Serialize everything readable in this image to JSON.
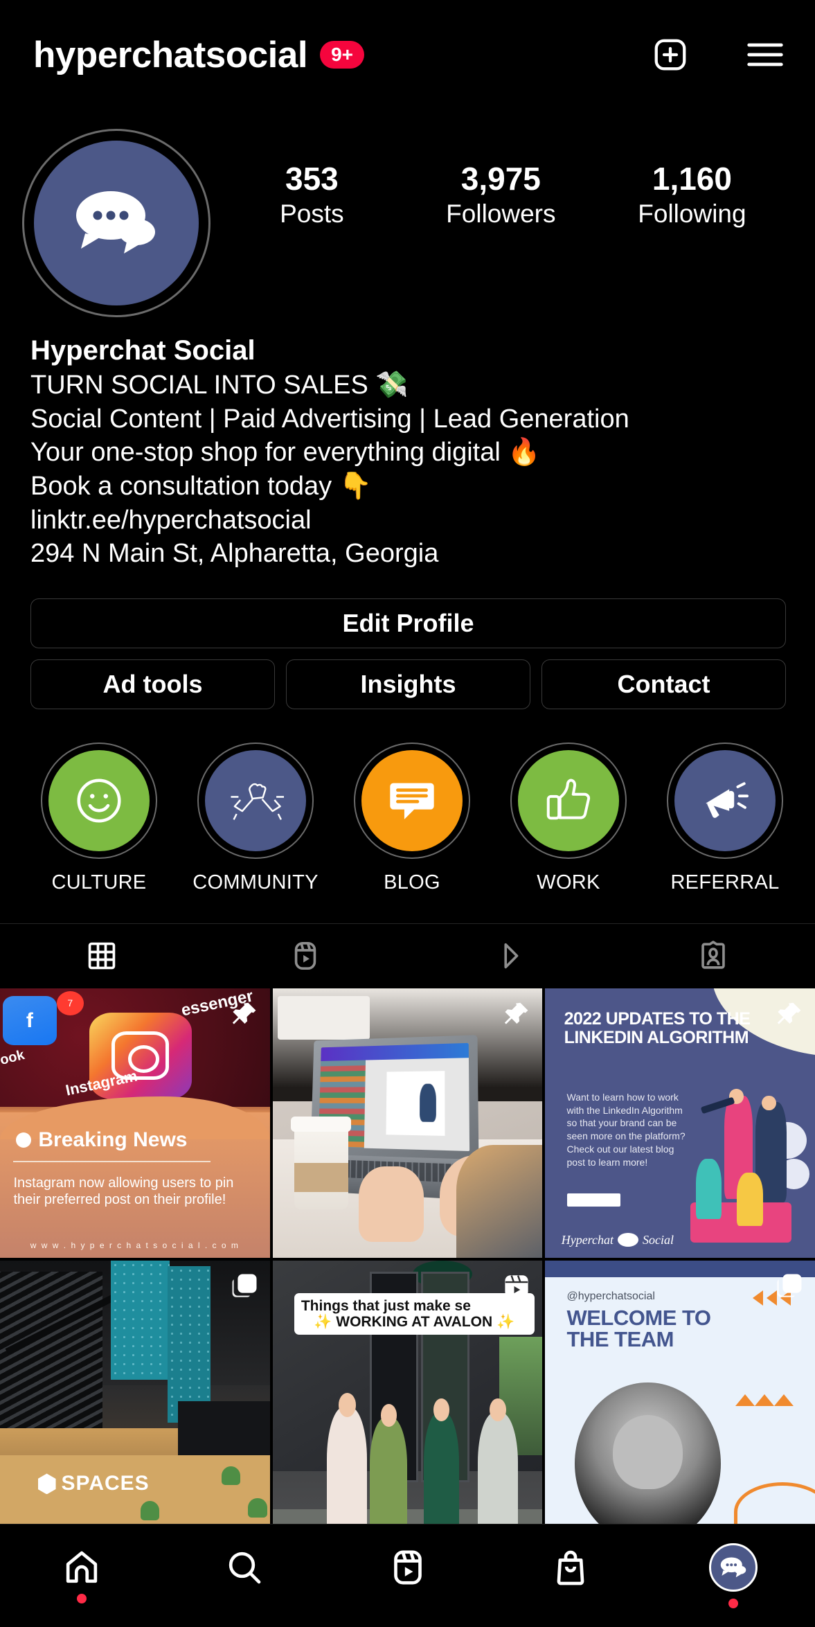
{
  "header": {
    "title": "hyperchatsocial",
    "badge": "9+",
    "add_icon": "plus-square-icon",
    "menu_icon": "hamburger-menu-icon"
  },
  "profile": {
    "avatar_icon": "chat-bubbles-icon",
    "avatar_color": "#4c5888",
    "stats": [
      {
        "value": "353",
        "label": "Posts"
      },
      {
        "value": "3,975",
        "label": "Followers"
      },
      {
        "value": "1,160",
        "label": "Following"
      }
    ],
    "display_name": "Hyperchat Social",
    "bio_lines": [
      "TURN SOCIAL INTO SALES 💸",
      "Social Content | Paid Advertising | Lead Generation",
      "Your one-stop shop for everything digital 🔥",
      "Book a consultation today 👇"
    ],
    "link": "linktr.ee/hyperchatsocial",
    "address": "294 N Main St, Alpharetta, Georgia"
  },
  "actions": {
    "edit_profile": "Edit Profile",
    "ad_tools": "Ad tools",
    "insights": "Insights",
    "contact": "Contact"
  },
  "highlights": [
    {
      "label": "CULTURE",
      "color": "#7dbb42",
      "icon": "smiley-face-icon"
    },
    {
      "label": "COMMUNITY",
      "color": "#4c5888",
      "icon": "handshake-icon"
    },
    {
      "label": "BLOG",
      "color": "#f89a0e",
      "icon": "chat-bubble-lines-icon"
    },
    {
      "label": "WORK",
      "color": "#7dbb42",
      "icon": "thumbs-up-icon"
    },
    {
      "label": "REFERRAL",
      "color": "#4c5888",
      "icon": "megaphone-icon"
    }
  ],
  "tabs": [
    {
      "name": "grid",
      "icon": "grid-icon",
      "active": true
    },
    {
      "name": "reels",
      "icon": "reels-icon",
      "active": false
    },
    {
      "name": "video",
      "icon": "play-icon",
      "active": false
    },
    {
      "name": "tagged",
      "icon": "tagged-icon",
      "active": false
    }
  ],
  "posts": [
    {
      "id": "post-breaking-news",
      "overlay": "pin-icon",
      "heading": "Breaking News",
      "body": "Instagram now allowing users to pin their preferred post on their profile!",
      "url": "w w w . h y p e r c h a t s o c i a l . c o m",
      "labels": {
        "messenger": "essenger",
        "facebook": "ook",
        "instagram": "Instagram",
        "fb_glyph": "f",
        "badge": "7"
      }
    },
    {
      "id": "post-laptop-work",
      "overlay": "pin-icon"
    },
    {
      "id": "post-linkedin-algorithm",
      "overlay": "pin-icon",
      "title": "2022 UPDATES TO THE LINKEDIN ALGORITHM",
      "body": "Want to learn how to work with the LinkedIn Algorithm so that your brand can be seen more on the platform? Check out our latest blog post to learn more!",
      "logo_left": "Hyperchat",
      "logo_right": "Social"
    },
    {
      "id": "post-spaces-office",
      "overlay": "carousel-icon",
      "brand": "SPACES"
    },
    {
      "id": "post-avalon-reel",
      "overlay": "reel-icon",
      "caption_line1": "Things that just make se",
      "caption_line2": "✨ WORKING AT AVALON ✨"
    },
    {
      "id": "post-welcome-team",
      "overlay": "carousel-icon",
      "handle": "@hyperchatsocial",
      "title_line1": "WELCOME TO",
      "title_line2": "THE TEAM"
    }
  ],
  "bottom_nav": [
    {
      "name": "home",
      "icon": "home-icon",
      "dot": true
    },
    {
      "name": "search",
      "icon": "search-icon",
      "dot": false
    },
    {
      "name": "reels",
      "icon": "reels-icon",
      "dot": false
    },
    {
      "name": "shop",
      "icon": "shop-bag-icon",
      "dot": false
    },
    {
      "name": "profile",
      "icon": "profile-avatar-icon",
      "dot": true
    }
  ],
  "colors": {
    "background": "#000000",
    "badge_red": "#f5053d",
    "brand_blue": "#4c5888",
    "brand_green": "#7dbb42",
    "brand_orange": "#f89a0e"
  }
}
